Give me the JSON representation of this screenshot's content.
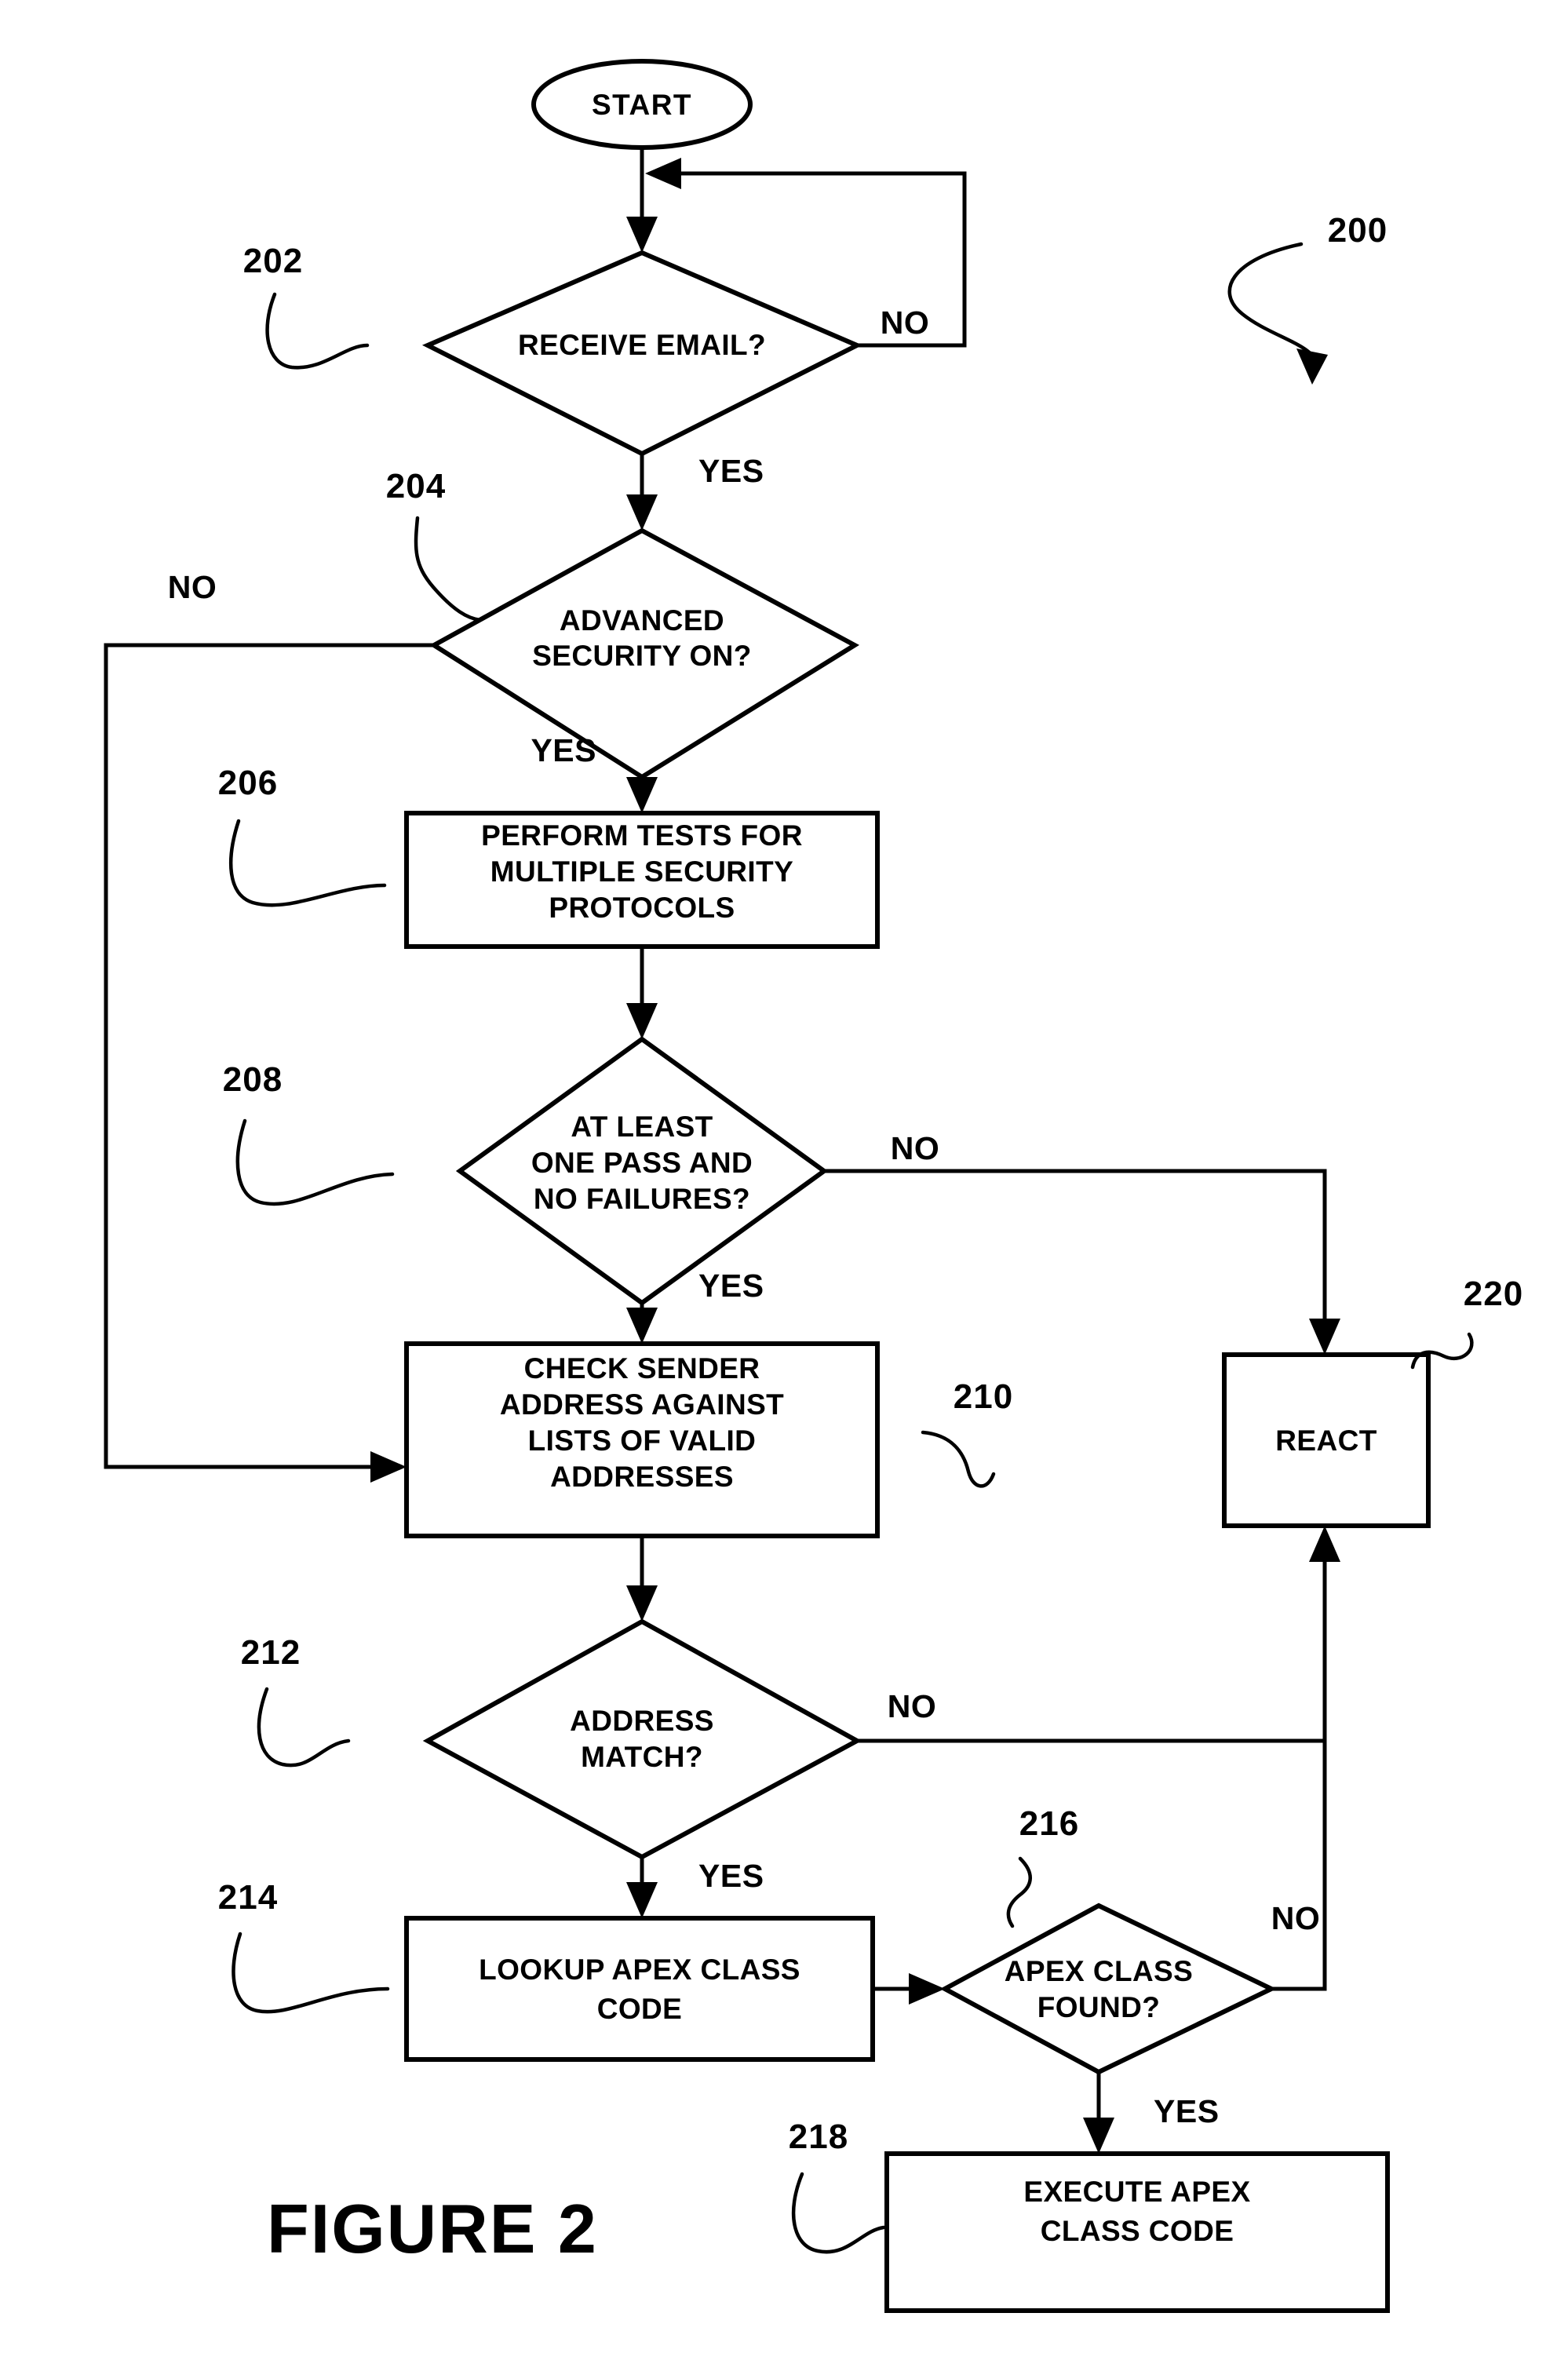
{
  "figure": {
    "caption": "FIGURE 2",
    "diagram_ref": "200"
  },
  "nodes": {
    "start": {
      "id": "start",
      "kind": "terminator",
      "label": "START"
    },
    "n202": {
      "id": "202",
      "kind": "decision",
      "ref": "202",
      "line1": "RECEIVE EMAIL?"
    },
    "n204": {
      "id": "204",
      "kind": "decision",
      "ref": "204",
      "line1": "ADVANCED",
      "line2": "SECURITY ON?"
    },
    "n206": {
      "id": "206",
      "kind": "process",
      "ref": "206",
      "line1": "PERFORM TESTS FOR",
      "line2": "MULTIPLE SECURITY",
      "line3": "PROTOCOLS"
    },
    "n208": {
      "id": "208",
      "kind": "decision",
      "ref": "208",
      "line1": "AT LEAST",
      "line2": "ONE PASS AND",
      "line3": "NO FAILURES?"
    },
    "n210": {
      "id": "210",
      "kind": "process",
      "ref": "210",
      "line1": "CHECK SENDER",
      "line2": "ADDRESS AGAINST",
      "line3": "LISTS OF VALID",
      "line4": "ADDRESSES"
    },
    "n212": {
      "id": "212",
      "kind": "decision",
      "ref": "212",
      "line1": "ADDRESS",
      "line2": "MATCH?"
    },
    "n214": {
      "id": "214",
      "kind": "process",
      "ref": "214",
      "line1": "LOOKUP APEX CLASS",
      "line2": "CODE"
    },
    "n216": {
      "id": "216",
      "kind": "decision",
      "ref": "216",
      "line1": "APEX CLASS",
      "line2": "FOUND?"
    },
    "n218": {
      "id": "218",
      "kind": "process",
      "ref": "218",
      "line1": "EXECUTE APEX",
      "line2": "CLASS CODE"
    },
    "n220": {
      "id": "220",
      "kind": "process",
      "ref": "220",
      "line1": "REACT"
    }
  },
  "branch_labels": {
    "b202_no": "NO",
    "b202_yes": "YES",
    "b204_no": "NO",
    "b204_yes": "YES",
    "b208_no": "NO",
    "b208_yes": "YES",
    "b212_no": "NO",
    "b212_yes": "YES",
    "b216_no": "NO",
    "b216_yes": "YES"
  },
  "colors": {
    "ink": "#000000",
    "paper": "#ffffff"
  },
  "chart_data": {
    "type": "diagram",
    "subtype": "flowchart",
    "title": "FIGURE 2",
    "diagram_reference_numeral": "200",
    "orientation": "top-to-bottom",
    "nodes": [
      {
        "ref": "start",
        "shape": "ellipse",
        "text": "START"
      },
      {
        "ref": "202",
        "shape": "diamond",
        "text": "RECEIVE EMAIL?"
      },
      {
        "ref": "204",
        "shape": "diamond",
        "text": "ADVANCED SECURITY ON?"
      },
      {
        "ref": "206",
        "shape": "rectangle",
        "text": "PERFORM TESTS FOR MULTIPLE SECURITY PROTOCOLS"
      },
      {
        "ref": "208",
        "shape": "diamond",
        "text": "AT LEAST ONE PASS AND NO FAILURES?"
      },
      {
        "ref": "210",
        "shape": "rectangle",
        "text": "CHECK SENDER ADDRESS AGAINST LISTS OF VALID ADDRESSES"
      },
      {
        "ref": "212",
        "shape": "diamond",
        "text": "ADDRESS MATCH?"
      },
      {
        "ref": "214",
        "shape": "rectangle",
        "text": "LOOKUP APEX CLASS CODE"
      },
      {
        "ref": "216",
        "shape": "diamond",
        "text": "APEX CLASS FOUND?"
      },
      {
        "ref": "218",
        "shape": "rectangle",
        "text": "EXECUTE APEX CLASS CODE"
      },
      {
        "ref": "220",
        "shape": "rectangle",
        "text": "REACT"
      }
    ],
    "edges": [
      {
        "from": "start",
        "to": "202",
        "label": ""
      },
      {
        "from": "202",
        "to": "start-to-202-link",
        "label": "NO"
      },
      {
        "from": "202",
        "to": "204",
        "label": "YES"
      },
      {
        "from": "204",
        "to": "210",
        "label": "NO"
      },
      {
        "from": "204",
        "to": "206",
        "label": "YES"
      },
      {
        "from": "206",
        "to": "208",
        "label": ""
      },
      {
        "from": "208",
        "to": "220",
        "label": "NO"
      },
      {
        "from": "208",
        "to": "210",
        "label": "YES"
      },
      {
        "from": "210",
        "to": "212",
        "label": ""
      },
      {
        "from": "212",
        "to": "220",
        "label": "NO"
      },
      {
        "from": "212",
        "to": "214",
        "label": "YES"
      },
      {
        "from": "214",
        "to": "216",
        "label": ""
      },
      {
        "from": "216",
        "to": "220",
        "label": "NO"
      },
      {
        "from": "216",
        "to": "218",
        "label": "YES"
      }
    ]
  }
}
